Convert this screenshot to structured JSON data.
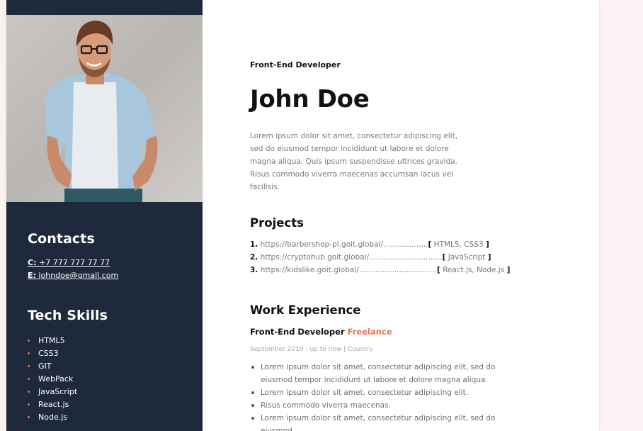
{
  "sidebar": {
    "contacts_heading": "Contacts",
    "phone_label": "C:",
    "phone": "+7 777 777 77 77",
    "email_label": "E:",
    "email": "johndoe@gmail.com",
    "skills_heading": "Tech Skills",
    "skills": [
      "HTML5",
      "CSS3",
      "GIT",
      "WebPack",
      "JavaScript",
      "React.js",
      "Node.js"
    ]
  },
  "profile": {
    "role": "Front-End Developer",
    "name": "John Doe",
    "intro": "Lorem ipsum dolor sit amet, consectetur adipiscing elit, sed do eiusmod tempor incididunt ut labore et dolore magna aliqua. Quis ipsum suspendisse ultrices gravida. Risus commodo viverra maecenas accumsan lacus vel facilisis."
  },
  "projects": {
    "heading": "Projects",
    "items": [
      {
        "num": "1.",
        "url": "https://barbershop-pl.goit.global/",
        "dots": "...................",
        "tech": "HTML5, CSS3"
      },
      {
        "num": "2.",
        "url": "https://cryptohub.goit.global/",
        "dots": "...............................",
        "tech": "JavaScript"
      },
      {
        "num": "3.",
        "url": "https://kidslike.goit.global/",
        "dots": ".................................",
        "tech": "React.js, Node.js"
      }
    ]
  },
  "experience": {
    "heading": "Work Experience",
    "job_title": "Front-End Developer",
    "job_type": "Freelance",
    "date": "September 2019 - up to now | Country",
    "duties": [
      "Lorem ipsum dolor sit amet, consectetur adipiscing elit, sed do eiusmod tempor incididunt ut labore et dolore magna aliqua.",
      "Lorem ipsum dolor sit amet, consectetur adipiscing elit.",
      "Risus commodo viverra maecenas.",
      "Lorem ipsum dolor sit amet, consectetur adipiscing elit, sed do eiusmod"
    ]
  },
  "colors": {
    "sidebar_bg": "#1e2a3b",
    "accent": "#e8734f",
    "page_bg": "#fbf3f3"
  }
}
